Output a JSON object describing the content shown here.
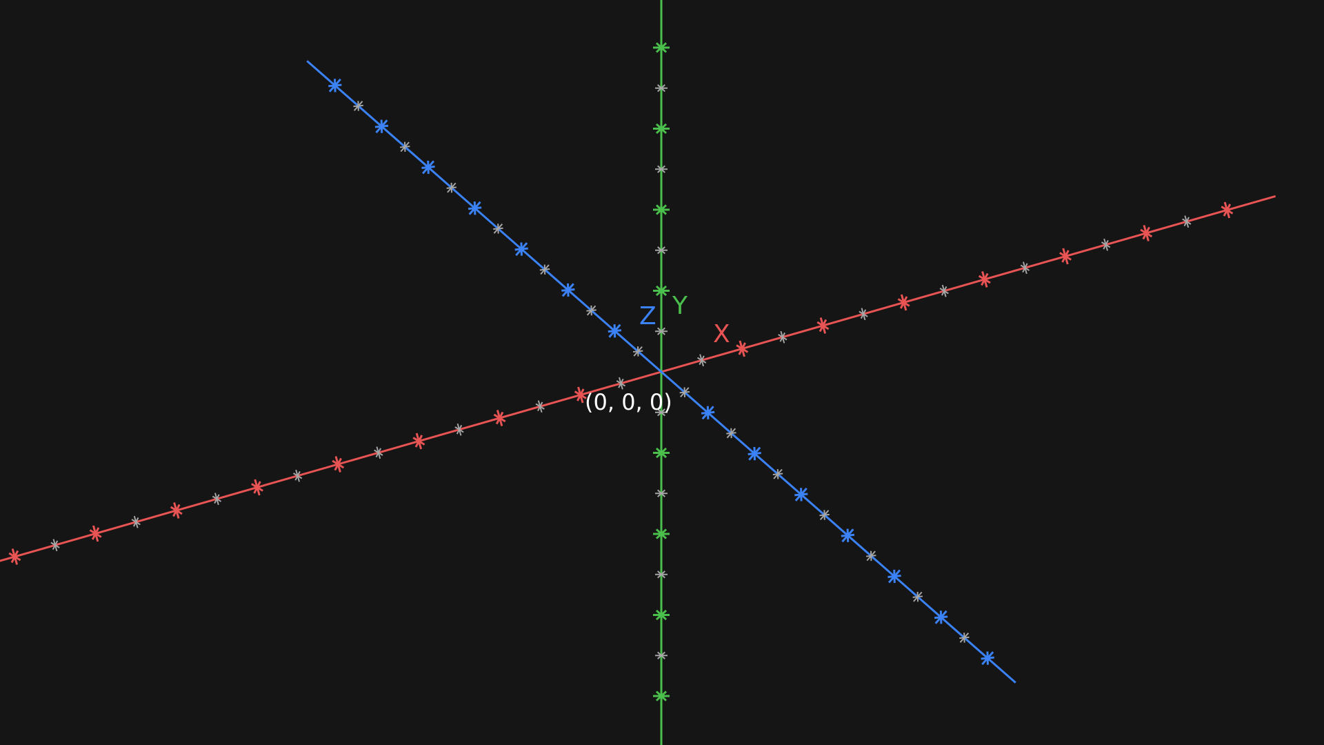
{
  "scene": {
    "background": "#151516",
    "minor_tick_color": "#a6a6a6",
    "origin_label": {
      "text": "(0, 0, 0)",
      "color": "#ffffff"
    },
    "axes": [
      {
        "key": "x",
        "label": "X",
        "color": "#e85454"
      },
      {
        "key": "y",
        "label": "Y",
        "color": "#4bbf4b"
      },
      {
        "key": "z",
        "label": "Z",
        "color": "#3b82f6"
      }
    ]
  }
}
